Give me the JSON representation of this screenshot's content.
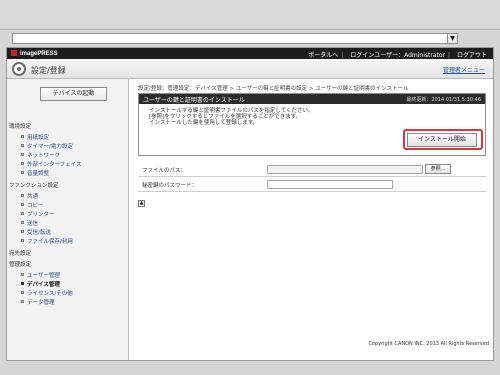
{
  "browser": {
    "address_value": "",
    "dropdown_glyph": "▼"
  },
  "topbar": {
    "brand": "imagePRESS",
    "links": [
      "ポータルへ",
      "ログインユーザー：Administrator",
      "ログアウト"
    ]
  },
  "titlebar": {
    "heading": "設定/登録",
    "admin_menu": "管理者メニュー"
  },
  "sidebar": {
    "device_start_label": "デバイスの起動",
    "groups": [
      {
        "label": "環境設定",
        "items": [
          "用紙設定",
          "タイマー/電力設定",
          "ネットワーク",
          "外部インターフェイス",
          "音量調整"
        ]
      },
      {
        "label": "ファンクション設定",
        "items": [
          "共通",
          "コピー",
          "プリンター",
          "送信",
          "受信/転送",
          "ファイル保存/利用"
        ]
      },
      {
        "label": "宛先設定",
        "items": []
      },
      {
        "label": "管理設定",
        "items": [
          "ユーザー管理",
          "デバイス管理",
          "ライセンス/その他",
          "データ管理"
        ]
      }
    ],
    "active_item": "デバイス管理"
  },
  "main": {
    "breadcrumb": "設定/登録：管理設定：デバイス管理 > ユーザーの鍵と証明書の設定 > ユーザーの鍵と証明書のインストール",
    "panel_title": "ユーザーの鍵と証明書のインストール",
    "panel_date": "最終更新：2014 01/31 5:30:46",
    "desc_lines": [
      "インストールする鍵と証明書ファイルのパスを指定してください。",
      "[参照]をクリックするとファイルを選択することができます。",
      "インストールした鍵を使用して登録します。"
    ],
    "install_button": "インストール開始",
    "file_path_label": "ファイルのパス：",
    "file_path_value": "",
    "browse_button": "参照...",
    "private_key_label": "秘密鍵のパスワード：",
    "private_key_value": "",
    "top_arrow": "▲",
    "copyright": "Copyright CANON INC. 2013 All Rights Reserved"
  }
}
